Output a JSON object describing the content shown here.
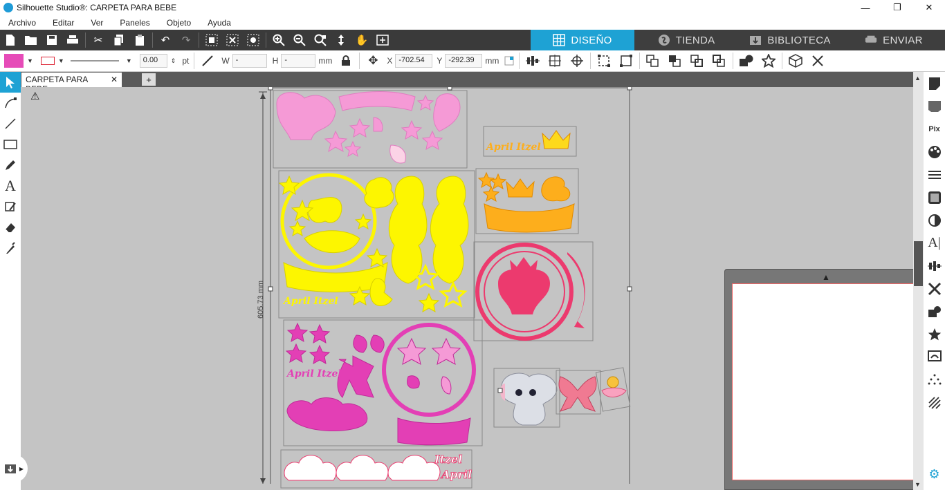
{
  "window": {
    "title": "Silhouette Studio®: CARPETA PARA BEBE",
    "min": "—",
    "restore": "❐",
    "close": "✕"
  },
  "menu": [
    "Archivo",
    "Editar",
    "Ver",
    "Paneles",
    "Objeto",
    "Ayuda"
  ],
  "nav_tabs": [
    {
      "label": "DISEÑO",
      "icon": "grid-icon",
      "active": true
    },
    {
      "label": "TIENDA",
      "icon": "store-icon",
      "active": false
    },
    {
      "label": "BIBLIOTECA",
      "icon": "library-icon",
      "active": false
    },
    {
      "label": "ENVIAR",
      "icon": "send-icon",
      "active": false
    }
  ],
  "toolbar2": {
    "fill_color": "#e64bb8",
    "line_width": "0.00",
    "line_unit": "pt",
    "w_label": "W",
    "w_value": "-",
    "h_label": "H",
    "h_value": "-",
    "size_unit": "mm",
    "x_label": "X",
    "x_value": "-702.54",
    "y_label": "Y",
    "y_value": "-292.39",
    "pos_unit": "mm"
  },
  "document_tab": {
    "name": "CARPETA PARA BEBE",
    "close": "✕",
    "add": "+"
  },
  "canvas": {
    "height_dimension": "605.73 mm",
    "labels": {
      "april_itzel_orange": "April Itzel",
      "april_itzel_yellow": "April Itzel",
      "april_itzel_pink": "April Itzel",
      "itzel_april_bottom_1": "Itzel",
      "itzel_april_bottom_2": "April"
    }
  },
  "colors": {
    "pink_light": "#f59ad6",
    "yellow": "#fdf600",
    "orange": "#fdae1c",
    "red_pink": "#ec3a6e",
    "magenta": "#e33fb5",
    "accent": "#1ea2d4"
  }
}
